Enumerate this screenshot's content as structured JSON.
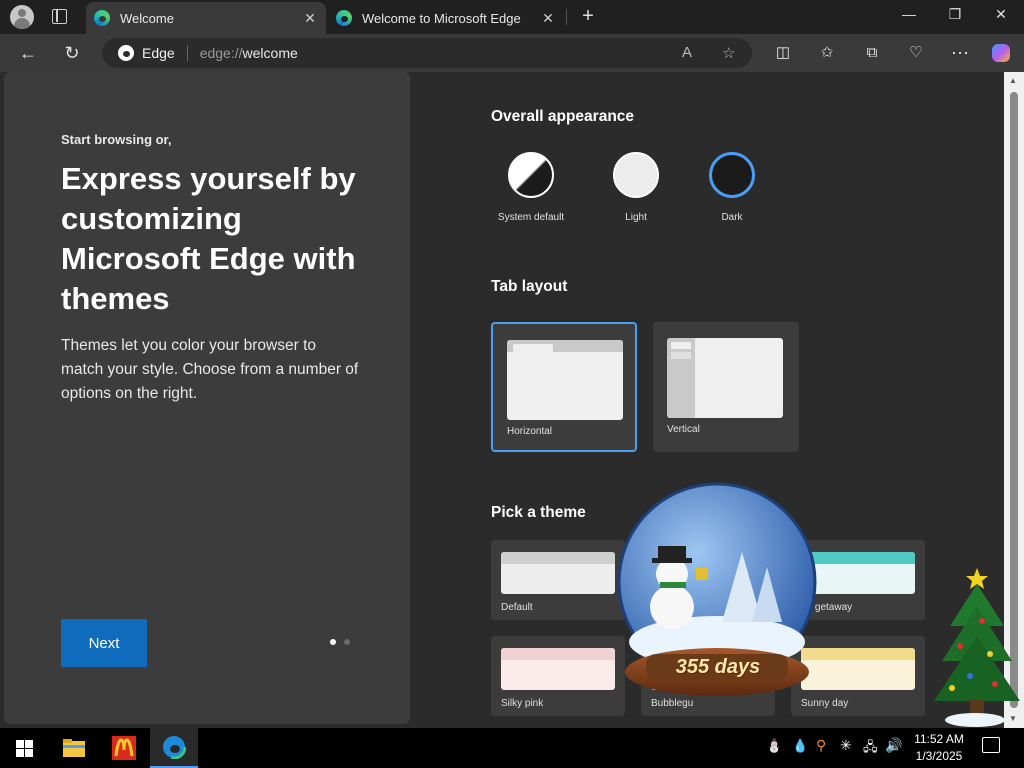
{
  "browser": {
    "tabs": [
      {
        "title": "Welcome",
        "active": true
      },
      {
        "title": "Welcome to Microsoft Edge",
        "active": false
      }
    ],
    "omnibox": {
      "site": "Edge",
      "url_prefix": "edge://",
      "url_path": "welcome"
    }
  },
  "welcome": {
    "eyebrow": "Start browsing or,",
    "headline": "Express yourself by customizing Microsoft Edge with themes",
    "description": "Themes let you color your browser to match your style. Choose from a number of options on the right.",
    "next_label": "Next"
  },
  "appearance": {
    "title": "Overall appearance",
    "options": [
      {
        "label": "System default"
      },
      {
        "label": "Light"
      },
      {
        "label": "Dark",
        "selected": true
      }
    ]
  },
  "tab_layout": {
    "title": "Tab layout",
    "options": [
      {
        "label": "Horizontal",
        "selected": true
      },
      {
        "label": "Vertical"
      }
    ]
  },
  "themes": {
    "title": "Pick a theme",
    "cards": [
      {
        "label": "Default",
        "color": "#e8e8e8"
      },
      {
        "label": "nd getaway",
        "color": "#4fc9c2"
      },
      {
        "label": "Silky pink",
        "color": "#f1d2d2"
      },
      {
        "label": "Bubblegu",
        "color": "#c78ad6"
      },
      {
        "label": "Sunny day",
        "color": "#f2dc8c"
      }
    ]
  },
  "overlay": {
    "countdown": "355 days"
  },
  "taskbar": {
    "time": "11:52 AM",
    "date": "1/3/2025"
  }
}
